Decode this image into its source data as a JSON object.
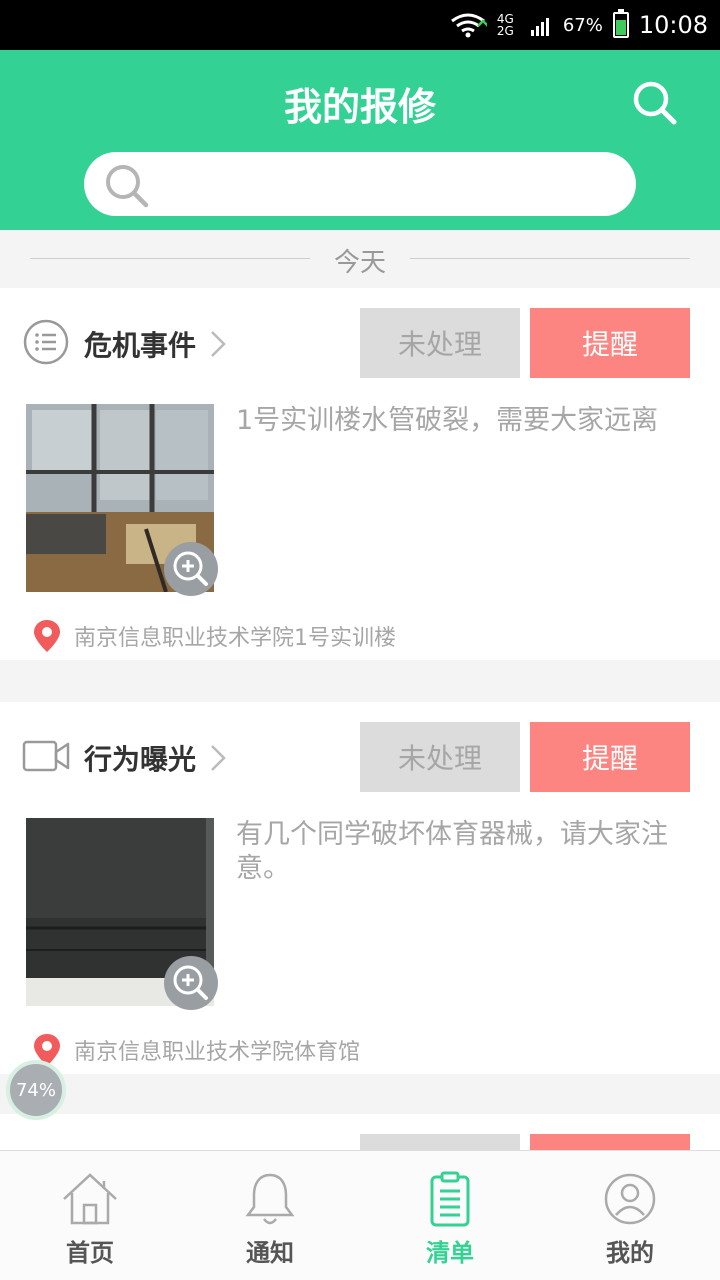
{
  "status_bar": {
    "network": "4G 2G",
    "battery": "67%",
    "time": "10:08"
  },
  "header": {
    "title": "我的报修",
    "search_placeholder": ""
  },
  "date_divider": "今天",
  "cards": [
    {
      "category": "危机事件",
      "status": "未处理",
      "remind": "提醒",
      "description": "1号实训楼水管破裂，需要大家远离",
      "location": "南京信息职业技术学院1号实训楼"
    },
    {
      "category": "行为曝光",
      "status": "未处理",
      "remind": "提醒",
      "description": "有几个同学破坏体育器械，请大家注意。",
      "location": "南京信息职业技术学院体育馆"
    }
  ],
  "progress_badge": "74%",
  "tabbar": [
    {
      "label": "首页",
      "icon": "home-icon"
    },
    {
      "label": "通知",
      "icon": "bell-icon"
    },
    {
      "label": "清单",
      "icon": "clipboard-icon",
      "active": true
    },
    {
      "label": "我的",
      "icon": "user-icon"
    }
  ],
  "colors": {
    "primary": "#34d195",
    "remind": "#fc8481",
    "status_bg": "#dcdcdc"
  }
}
